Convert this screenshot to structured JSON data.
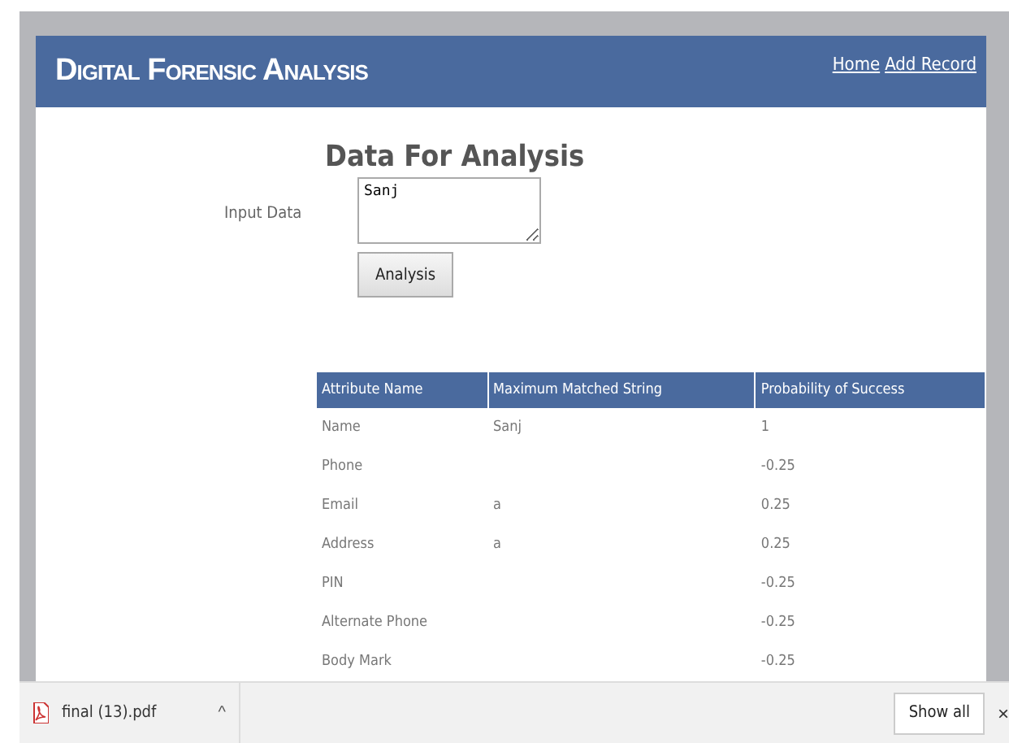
{
  "header": {
    "title": "Digital Forensic Analysis",
    "links": [
      "Home",
      "Add Record"
    ]
  },
  "form": {
    "heading": "Data For Analysis",
    "label": "Input Data",
    "value": "Sanj",
    "button": "Analysis"
  },
  "table": {
    "columns": [
      "Attribute Name",
      "Maximum Matched String",
      "Probability of Success"
    ],
    "rows": [
      [
        "Name",
        "Sanj",
        "1"
      ],
      [
        "Phone",
        "",
        "-0.25"
      ],
      [
        "Email",
        "a",
        "0.25"
      ],
      [
        "Address",
        "a",
        "0.25"
      ],
      [
        "PIN",
        "",
        "-0.25"
      ],
      [
        "Alternate Phone",
        "",
        "-0.25"
      ],
      [
        "Body Mark",
        "",
        "-0.25"
      ]
    ]
  },
  "download_bar": {
    "file": "final (13).pdf",
    "caret": "^",
    "show_all": "Show all",
    "close": "×"
  }
}
